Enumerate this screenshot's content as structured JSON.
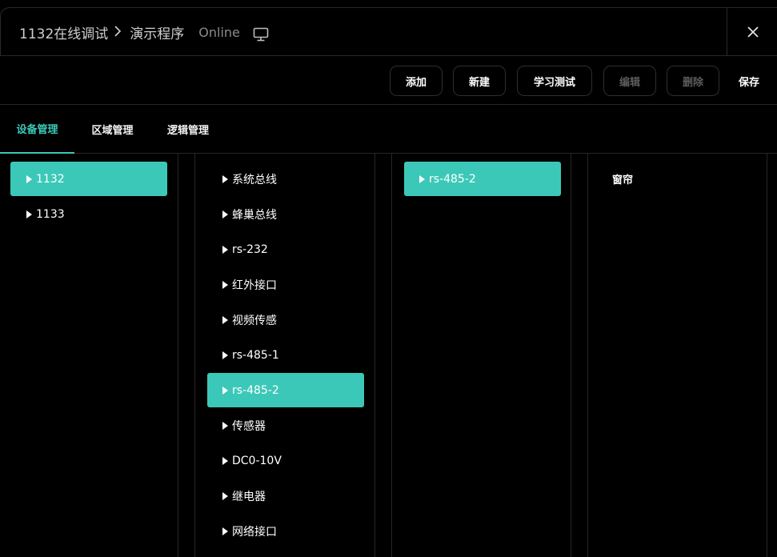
{
  "header": {
    "breadcrumb_device": "1132在线调试",
    "breadcrumb_program": "演示程序",
    "status": "Online"
  },
  "toolbar": {
    "add": "添加",
    "new": "新建",
    "learn_test": "学习测试",
    "edit": "编辑",
    "delete": "删除",
    "save": "保存"
  },
  "tabs": [
    "设备管理",
    "区域管理",
    "逻辑管理"
  ],
  "active_tab": "设备管理",
  "columns": {
    "devices": [
      "1132",
      "1133"
    ],
    "interfaces": [
      "系统总线",
      "蜂巢总线",
      "rs-232",
      "红外接口",
      "视频传感",
      "rs-485-1",
      "rs-485-2",
      "传感器",
      "DC0-10V",
      "继电器",
      "网络接口"
    ],
    "ports": [
      "rs-485-2"
    ],
    "endpoints": [
      "窗帘"
    ]
  },
  "selected": {
    "device": "1132",
    "interface": "rs-485-2",
    "port": "rs-485-2"
  },
  "colors": {
    "accent": "#3cc8b8",
    "background": "#000000",
    "disabled_text": "#5c5c5c"
  }
}
